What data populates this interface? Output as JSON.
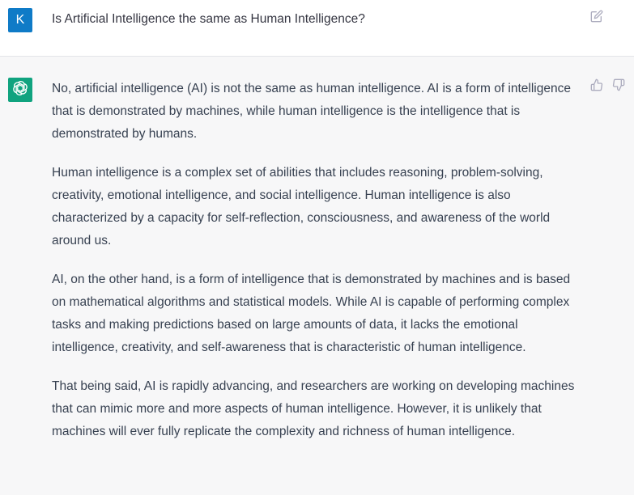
{
  "user_message": {
    "avatar_letter": "K",
    "text": "Is Artificial Intelligence the same as Human Intelligence?"
  },
  "assistant_message": {
    "paragraphs": [
      "No, artificial intelligence (AI) is not the same as human intelligence. AI is a form of intelligence that is demonstrated by machines, while human intelligence is the intelligence that is demonstrated by humans.",
      "Human intelligence is a complex set of abilities that includes reasoning, problem-solving, creativity, emotional intelligence, and social intelligence. Human intelligence is also characterized by a capacity for self-reflection, consciousness, and awareness of the world around us.",
      "AI, on the other hand, is a form of intelligence that is demonstrated by machines and is based on mathematical algorithms and statistical models. While AI is capable of performing complex tasks and making predictions based on large amounts of data, it lacks the emotional intelligence, creativity, and self-awareness that is characteristic of human intelligence.",
      "That being said, AI is rapidly advancing, and researchers are working on developing machines that can mimic more and more aspects of human intelligence. However, it is unlikely that machines will ever fully replicate the complexity and richness of human intelligence."
    ]
  },
  "icons": {
    "edit": "edit-icon",
    "thumbs_up": "thumbs-up-icon",
    "thumbs_down": "thumbs-down-icon",
    "bot_logo": "openai-logo-icon"
  },
  "colors": {
    "user_avatar_bg": "#0f7bc7",
    "bot_avatar_bg": "#10a37f",
    "assistant_bg": "#f7f7f8"
  }
}
